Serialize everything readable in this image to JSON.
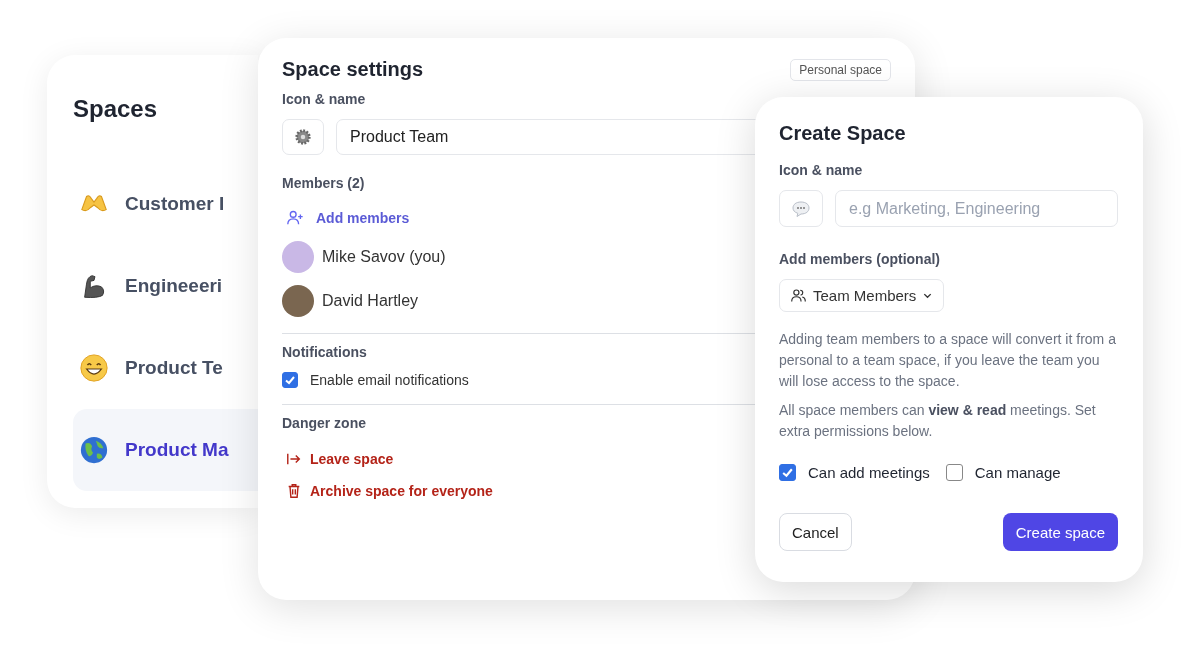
{
  "spaces_panel": {
    "title": "Spaces",
    "items": [
      {
        "label": "Customer I",
        "selected": false
      },
      {
        "label": "Engineeeri",
        "selected": false
      },
      {
        "label": "Product Te",
        "selected": false
      },
      {
        "label": "Product Ma",
        "selected": true
      }
    ]
  },
  "space_settings": {
    "title": "Space settings",
    "badge": "Personal space",
    "icon_name_label": "Icon & name",
    "name_value": "Product Team",
    "members_label": "Members (2)",
    "add_members": "Add members",
    "members": [
      {
        "name": "Mike Savov (you)"
      },
      {
        "name": "David Hartley"
      }
    ],
    "notifications_label": "Notifications",
    "notifications": [
      {
        "label": "Enable email notifications",
        "checked": true
      }
    ],
    "danger_label": "Danger zone",
    "danger_actions": [
      {
        "kind": "leave",
        "label": "Leave space"
      },
      {
        "kind": "archive",
        "label": "Archive space for everyone"
      }
    ]
  },
  "create_space": {
    "title": "Create Space",
    "icon_name_label": "Icon & name",
    "name_placeholder": "e.g Marketing, Engineering",
    "members_label": "Add members (optional)",
    "members_dropdown": "Team Members",
    "description": "Adding team members to a space will convert it from a personal to a team space, if you leave the team you will lose access to the space.",
    "permissions_note": "All space members can **view & read** meetings. Set extra permissions below.",
    "permissions": [
      {
        "label": "Can add meetings",
        "checked": true
      },
      {
        "label": "Can manage",
        "checked": false
      }
    ],
    "buttons": [
      {
        "kind": "secondary",
        "label": "Cancel"
      },
      {
        "kind": "primary",
        "label": "Create space"
      }
    ]
  }
}
